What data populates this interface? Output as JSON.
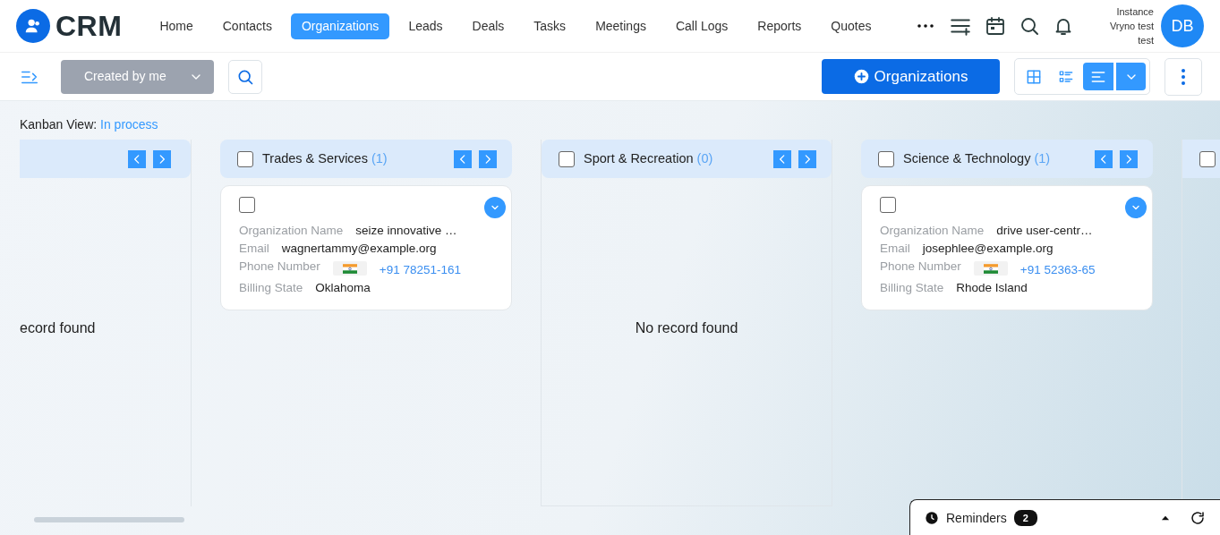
{
  "app": {
    "logo": "CRM"
  },
  "nav": [
    {
      "label": "Home",
      "selected": false
    },
    {
      "label": "Contacts",
      "selected": false
    },
    {
      "label": "Organizations",
      "selected": true
    },
    {
      "label": "Leads",
      "selected": false
    },
    {
      "label": "Deals",
      "selected": false
    },
    {
      "label": "Tasks",
      "selected": false
    },
    {
      "label": "Meetings",
      "selected": false
    },
    {
      "label": "Call Logs",
      "selected": false
    },
    {
      "label": "Reports",
      "selected": false
    },
    {
      "label": "Quotes",
      "selected": false
    }
  ],
  "user": {
    "lines": [
      "Instance",
      "Vryno test",
      "test"
    ],
    "initials": "DB"
  },
  "toolbar": {
    "filter": "Created by me",
    "add_button": "Organizations",
    "views": [
      {
        "kind": "grid",
        "selected": false
      },
      {
        "kind": "list",
        "selected": false
      },
      {
        "kind": "kanban",
        "selected": true
      }
    ]
  },
  "view_label": {
    "label": "Kanban View:",
    "value": "In process"
  },
  "columns": [
    {
      "kind": "partial",
      "empty_text": "ecord found"
    },
    {
      "kind": "full",
      "title": "Trades & Services",
      "count": "(1)",
      "checked": false,
      "cards": [
        {
          "checked": false,
          "fields": [
            {
              "kind": "text",
              "label": "Organization Name",
              "value": "seize innovative …"
            },
            {
              "kind": "text",
              "label": "Email",
              "value": "wagnertammy@example.org"
            },
            {
              "kind": "phone",
              "label": "Phone Number",
              "value": "+91 78251-161"
            },
            {
              "kind": "text",
              "label": "Billing State",
              "value": "Oklahoma"
            }
          ]
        }
      ]
    },
    {
      "kind": "full",
      "title": "Sport & Recreation",
      "count": "(0)",
      "checked": false,
      "empty_text": "No record found"
    },
    {
      "kind": "full",
      "title": "Science & Technology",
      "count": "(1)",
      "checked": false,
      "cards": [
        {
          "checked": false,
          "fields": [
            {
              "kind": "text",
              "label": "Organization Name",
              "value": "drive user-centr…"
            },
            {
              "kind": "text",
              "label": "Email",
              "value": "josephlee@example.org"
            },
            {
              "kind": "phone",
              "label": "Phone Number",
              "value": "+91 52363-65"
            },
            {
              "kind": "text",
              "label": "Billing State",
              "value": "Rhode Island"
            }
          ]
        }
      ]
    },
    {
      "kind": "stub",
      "checked": false
    }
  ],
  "reminders": {
    "label": "Reminders",
    "count": "2"
  }
}
